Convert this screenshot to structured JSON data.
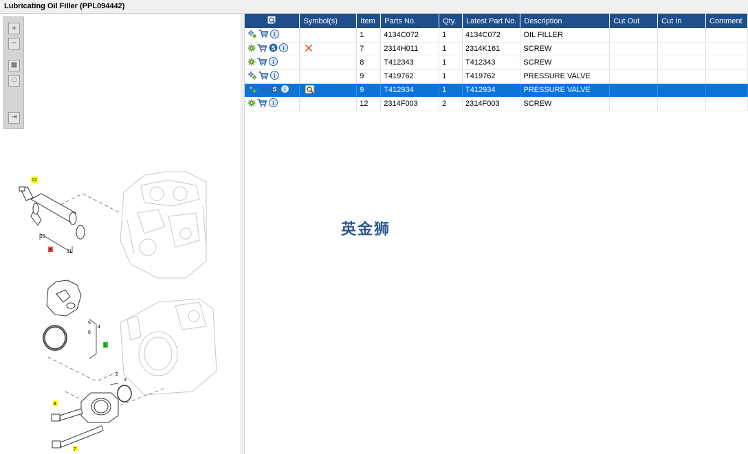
{
  "window": {
    "title": "Lubricating Oil Filler (PPL094442)"
  },
  "toolbar": {
    "buttons": [
      {
        "name": "zoom-in-icon"
      },
      {
        "name": "zoom-out-icon"
      },
      {
        "name": "fit-all-icon"
      },
      {
        "name": "fit-window-icon"
      },
      {
        "name": "export-icon"
      }
    ]
  },
  "diagram": {
    "callouts": [
      {
        "label": "12",
        "color": "#ffff00"
      },
      {
        "label": "9",
        "color": "#ff4d4d"
      },
      {
        "label": "1",
        "color": "#33cc33"
      },
      {
        "label": "8",
        "color": "#ffff00"
      },
      {
        "label": "7",
        "color": "#ffff00"
      }
    ],
    "subparts": [
      "10",
      "11",
      "5",
      "6",
      "4",
      "2",
      "3"
    ]
  },
  "table": {
    "headers": {
      "symbols": "Symbol(s)",
      "item": "Item",
      "parts_no": "Parts No.",
      "qty": "Qty.",
      "latest": "Latest Part No.",
      "desc": "Description",
      "cut_out": "Cut Out",
      "cut_in": "Cut In",
      "comment": "Comment"
    },
    "rows": [
      {
        "icons": [
          "gears-icon",
          "cart-icon",
          "info-icon"
        ],
        "symbol": "",
        "item": "1",
        "parts_no": "4134C072",
        "qty": "1",
        "latest": "4134C072",
        "desc": "OIL FILLER",
        "selected": false
      },
      {
        "icons": [
          "gear-icon",
          "cart-icon",
          "s-icon",
          "info-icon"
        ],
        "symbol": "cross-icon",
        "item": "7",
        "parts_no": "2314H011",
        "qty": "1",
        "latest": "2314K161",
        "desc": "SCREW",
        "selected": false
      },
      {
        "icons": [
          "gear-icon",
          "cart-icon",
          "info-icon"
        ],
        "symbol": "",
        "item": "8",
        "parts_no": "T412343",
        "qty": "1",
        "latest": "T412343",
        "desc": "SCREW",
        "selected": false
      },
      {
        "icons": [
          "gears-icon",
          "cart-icon",
          "info-icon"
        ],
        "symbol": "",
        "item": "9",
        "parts_no": "T419762",
        "qty": "1",
        "latest": "T419762",
        "desc": "PRESSURE VALVE",
        "selected": false
      },
      {
        "icons": [
          "gears-icon",
          "cart-icon",
          "s-icon",
          "info-icon"
        ],
        "symbol": "view-icon",
        "item": "9",
        "parts_no": "T412934",
        "qty": "1",
        "latest": "T412934",
        "desc": "PRESSURE VALVE",
        "selected": true
      },
      {
        "icons": [
          "gear-icon",
          "cart-icon",
          "info-icon"
        ],
        "symbol": "",
        "item": "12",
        "parts_no": "2314F003",
        "qty": "2",
        "latest": "2314F003",
        "desc": "SCREW",
        "selected": false
      }
    ]
  },
  "watermark": {
    "text": "英金狮"
  }
}
